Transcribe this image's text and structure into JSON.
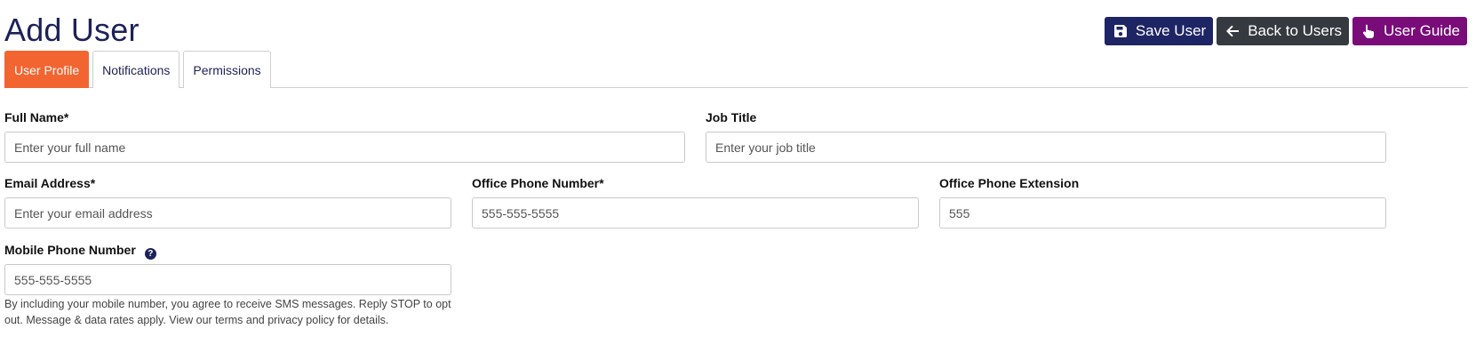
{
  "header": {
    "title": "Add User",
    "buttons": {
      "save": "Save User",
      "back": "Back to Users",
      "guide": "User Guide"
    }
  },
  "tabs": [
    {
      "label": "User Profile",
      "active": true
    },
    {
      "label": "Notifications",
      "active": false
    },
    {
      "label": "Permissions",
      "active": false
    }
  ],
  "form": {
    "full_name": {
      "label": "Full Name*",
      "value": "",
      "placeholder": "Enter your full name"
    },
    "job_title": {
      "label": "Job Title",
      "value": "",
      "placeholder": "Enter your job title"
    },
    "email": {
      "label": "Email Address*",
      "value": "",
      "placeholder": "Enter your email address"
    },
    "office_phone": {
      "label": "Office Phone Number*",
      "value": "",
      "placeholder": "555-555-5555"
    },
    "office_ext": {
      "label": "Office Phone Extension",
      "value": "",
      "placeholder": "555"
    },
    "mobile_phone": {
      "label": "Mobile Phone Number",
      "value": "",
      "placeholder": "555-555-5555"
    }
  },
  "sms_note": "By including your mobile number, you agree to receive SMS messages. Reply STOP to opt out. Message & data rates apply. View our terms and privacy policy for details.",
  "icons": {
    "save": "floppy-disk-icon",
    "back": "arrow-left-icon",
    "guide": "pointing-hand-icon",
    "help": "question-circle-icon"
  },
  "colors": {
    "title": "#1c2257",
    "save_button": "#1e2564",
    "back_button": "#343a40",
    "guide_button": "#7a0c7a",
    "active_tab": "#f26531"
  }
}
